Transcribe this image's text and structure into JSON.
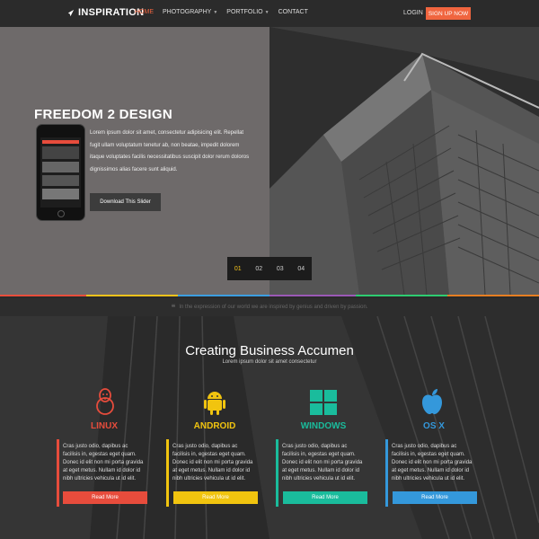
{
  "nav": {
    "brand": "INSPIRATION",
    "items": [
      {
        "label": "HOME",
        "active": true,
        "dropdown": false
      },
      {
        "label": "PHOTOGRAPHY",
        "active": false,
        "dropdown": true
      },
      {
        "label": "PORTFOLIO",
        "active": false,
        "dropdown": true
      },
      {
        "label": "CONTACT",
        "active": false,
        "dropdown": false
      }
    ],
    "login": "LOGIN",
    "signup": "SIGN UP NOW"
  },
  "hero": {
    "title": "FREEDOM 2 DESIGN",
    "text": "Lorem ipsum dolor sit amet, consectetur adipisicing elit. Repellat fugit ullam voluptatum tenetur ab, non beatae, impedit dolorem itaque voluptates facilis necessitatibus suscipit dolor rerum doloros dignissimos alias facere sunt aliquid.",
    "button": "Download This Slider",
    "pager": [
      "01",
      "02",
      "03",
      "04"
    ],
    "active_slide": "01"
  },
  "quote": {
    "text": "In the expression of our world we are inspired by genius and driven by passion."
  },
  "features": {
    "title": "Creating Business Accumen",
    "subtitle": "Lorem ipsum dolor sit amet consectetur",
    "columns": [
      {
        "name": "LINUX",
        "icon": "linux-icon",
        "color": "#e74c3c",
        "text": "Cras justo odio, dapibus ac facilisis in, egestas eget quam. Donec id elit non mi porta gravida at eget metus. Nullam id dolor id nibh ultricies vehicula ut id elit.",
        "button": "Read More"
      },
      {
        "name": "ANDROID",
        "icon": "android-icon",
        "color": "#f1c40f",
        "text": "Cras justo odio, dapibus ac facilisis in, egestas eget quam. Donec id elit non mi porta gravida at eget metus. Nullam id dolor id nibh ultricies vehicula ut id elit.",
        "button": "Read More"
      },
      {
        "name": "WINDOWS",
        "icon": "windows-icon",
        "color": "#1abc9c",
        "text": "Cras justo odio, dapibus ac facilisis in, egestas eget quam. Donec id elit non mi porta gravida at eget metus. Nullam id dolor id nibh ultricies vehicula ut id elit.",
        "button": "Read More"
      },
      {
        "name": "OS X",
        "icon": "apple-icon",
        "color": "#3498db",
        "text": "Cras justo odio, dapibus ac facilisis in, egestas eget quam. Donec id elit non mi porta gravida at eget metus. Nullam id dolor id nibh ultricies vehicula ut id elit.",
        "button": "Read More"
      }
    ]
  }
}
